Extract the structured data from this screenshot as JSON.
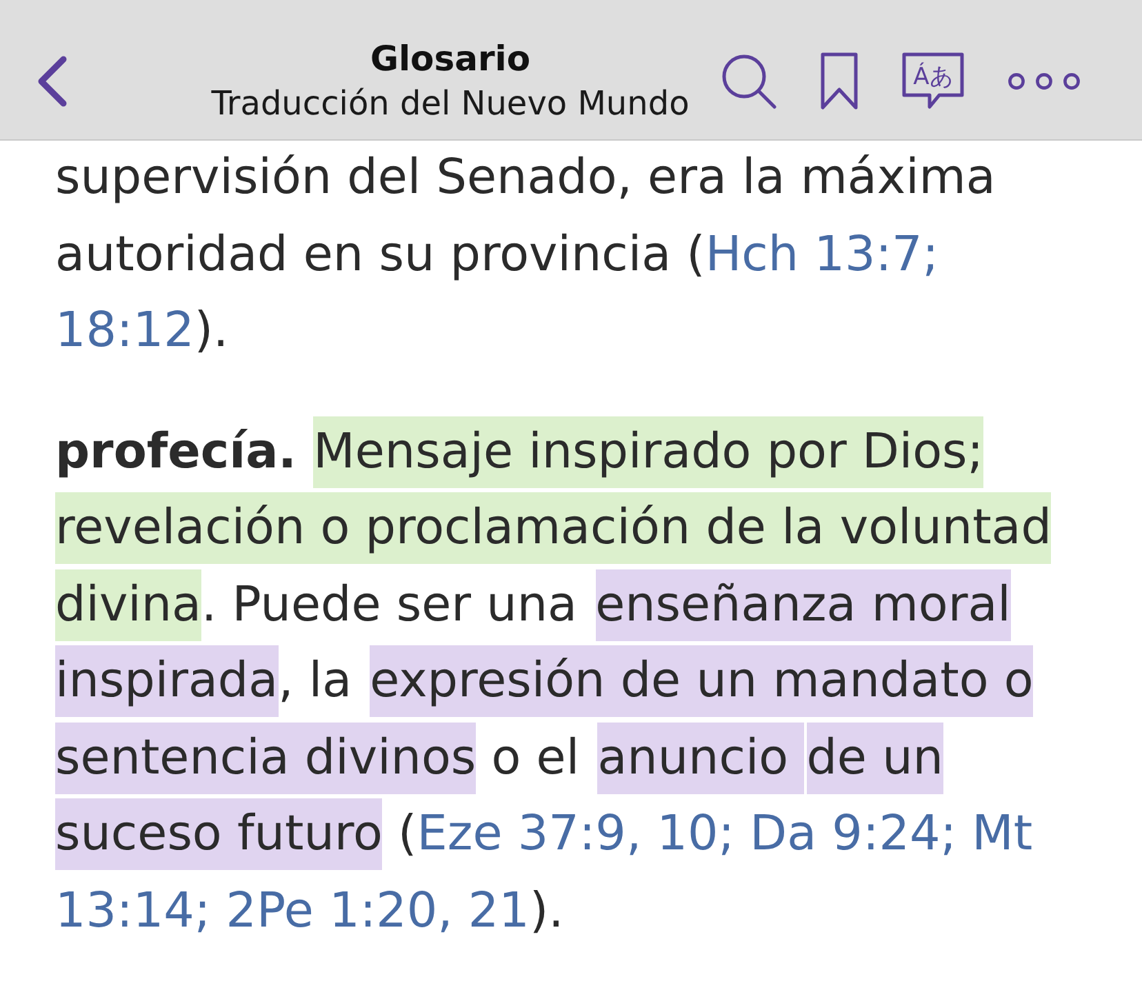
{
  "header": {
    "title": "Glosario",
    "subtitle": "Traducción del Nuevo Mundo",
    "actions": [
      {
        "kind": "search"
      },
      {
        "kind": "bookmark"
      },
      {
        "kind": "translate",
        "glyphs": "Áあ"
      },
      {
        "kind": "more"
      }
    ]
  },
  "entries": [
    {
      "lines": [
        [
          {
            "kind": "plain",
            "text": "supervisión del Senado, era la máxima"
          }
        ],
        [
          {
            "kind": "plain",
            "text": "autoridad en su provincia ("
          },
          {
            "kind": "link",
            "text": "Hch 13:7;"
          }
        ],
        [
          {
            "kind": "link",
            "text": "18:12"
          },
          {
            "kind": "plain",
            "text": ")."
          }
        ]
      ]
    },
    {
      "lines": [
        [
          {
            "kind": "term",
            "text": "profecía. "
          },
          {
            "kind": "highlight",
            "text": "Mensaje inspirado por Dios;",
            "color": "#dcf0cd"
          }
        ],
        [
          {
            "kind": "highlight",
            "text": "revelación o proclamación de la voluntad",
            "color": "#dcf0cd"
          }
        ],
        [
          {
            "kind": "highlight",
            "text": "divina",
            "color": "#dcf0cd"
          },
          {
            "kind": "plain",
            "text": ". Puede ser una "
          },
          {
            "kind": "highlight",
            "text": "enseñanza moral",
            "color": "#e0d4f0"
          }
        ],
        [
          {
            "kind": "highlight",
            "text": "inspirada",
            "color": "#e0d4f0"
          },
          {
            "kind": "plain",
            "text": ", la "
          },
          {
            "kind": "highlight",
            "text": "expresión de un mandato o",
            "color": "#e0d4f0"
          }
        ],
        [
          {
            "kind": "highlight",
            "text": "sentencia divinos",
            "color": "#e0d4f0"
          },
          {
            "kind": "plain",
            "text": " o el "
          },
          {
            "kind": "highlight",
            "text": "anuncio ",
            "color": "#e0d4f0"
          },
          {
            "kind": "highlight",
            "text": "de un",
            "color": "#e0d4f0"
          }
        ],
        [
          {
            "kind": "highlight",
            "text": "suceso futuro",
            "color": "#e0d4f0"
          },
          {
            "kind": "plain",
            "text": " ("
          },
          {
            "kind": "link",
            "text": "Eze 37:9, 10; Da 9:24; Mt"
          }
        ],
        [
          {
            "kind": "link",
            "text": "13:14; 2Pe 1:20, 21"
          },
          {
            "kind": "plain",
            "text": ")."
          }
        ]
      ]
    }
  ]
}
